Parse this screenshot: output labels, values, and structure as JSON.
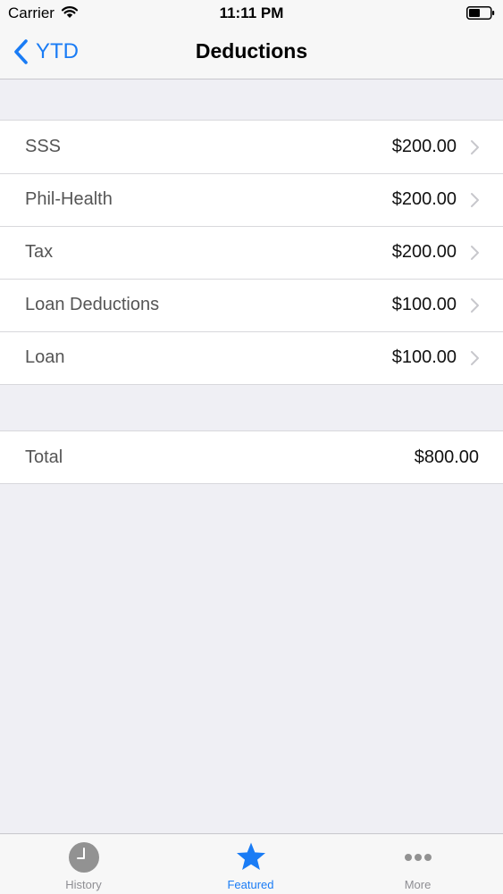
{
  "status_bar": {
    "carrier": "Carrier",
    "time": "11:11 PM",
    "wifi_icon": "wifi-icon",
    "battery_icon": "battery-icon"
  },
  "nav": {
    "back_label": "YTD",
    "title": "Deductions",
    "accent_color": "#1a7cf5"
  },
  "deductions": [
    {
      "label": "SSS",
      "amount": "$200.00"
    },
    {
      "label": "Phil-Health",
      "amount": "$200.00"
    },
    {
      "label": "Tax",
      "amount": "$200.00"
    },
    {
      "label": "Loan Deductions",
      "amount": "$100.00"
    },
    {
      "label": "Loan",
      "amount": "$100.00"
    }
  ],
  "total": {
    "label": "Total",
    "amount": "$800.00"
  },
  "tab_bar": {
    "selected": "Featured",
    "tabs": [
      {
        "label": "History",
        "icon": "clock-icon"
      },
      {
        "label": "Featured",
        "icon": "star-icon"
      },
      {
        "label": "More",
        "icon": "more-icon"
      }
    ]
  }
}
